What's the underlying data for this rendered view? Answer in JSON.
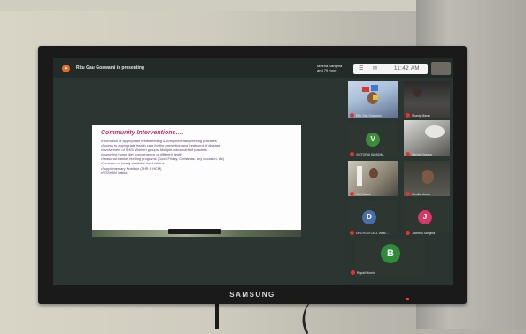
{
  "device": {
    "brand": "SAMSUNG"
  },
  "meeting": {
    "presenting_text": "Ritu Gau Goswami is presenting",
    "speaker_label_line1": "Meena Sangma",
    "speaker_label_line2": "and 79 more",
    "time": "11:42 AM"
  },
  "slide": {
    "title": "Community Interventions….",
    "bullets": [
      "Promotion of appropriate breastfeeding & complementary feeding practices",
      "Access to appropriate health care for the prevention and treatment of disease",
      "Involvement of SHG/ Women groups/ Multiple-micronutrient powders",
      "Improving home diet (convergence of different deptt)",
      "Seasonal blanket feeding programs (Good Friday, Christmas, any occasion, etc)",
      "Provision of locally available food rations",
      "Supplementary Nutrition (THR & HCM)",
      "POSHAN Vatika"
    ]
  },
  "participants": [
    {
      "name": "Ritu Gau Goswami",
      "initial": ""
    },
    {
      "name": "Shanty Marak",
      "initial": ""
    },
    {
      "name": "VICTORIA SANGMA",
      "initial": "V",
      "color": "#3e8c3a"
    },
    {
      "name": "Sacha Kharsyn",
      "initial": ""
    },
    {
      "name": "Gini Marak",
      "initial": ""
    },
    {
      "name": "Cecilia Momin",
      "initial": ""
    },
    {
      "name": "DPO KGN CELL West ...",
      "initial": "D",
      "color": "#4a6fa8"
    },
    {
      "name": "Jacintha Sangma",
      "initial": "J",
      "color": "#d23a6a"
    },
    {
      "name": "Rupali Momin",
      "initial": "B",
      "color": "#2f8a3a"
    }
  ],
  "icons": [
    "presenting-icon",
    "people-icon",
    "chat-icon",
    "mic-muted-icon"
  ]
}
